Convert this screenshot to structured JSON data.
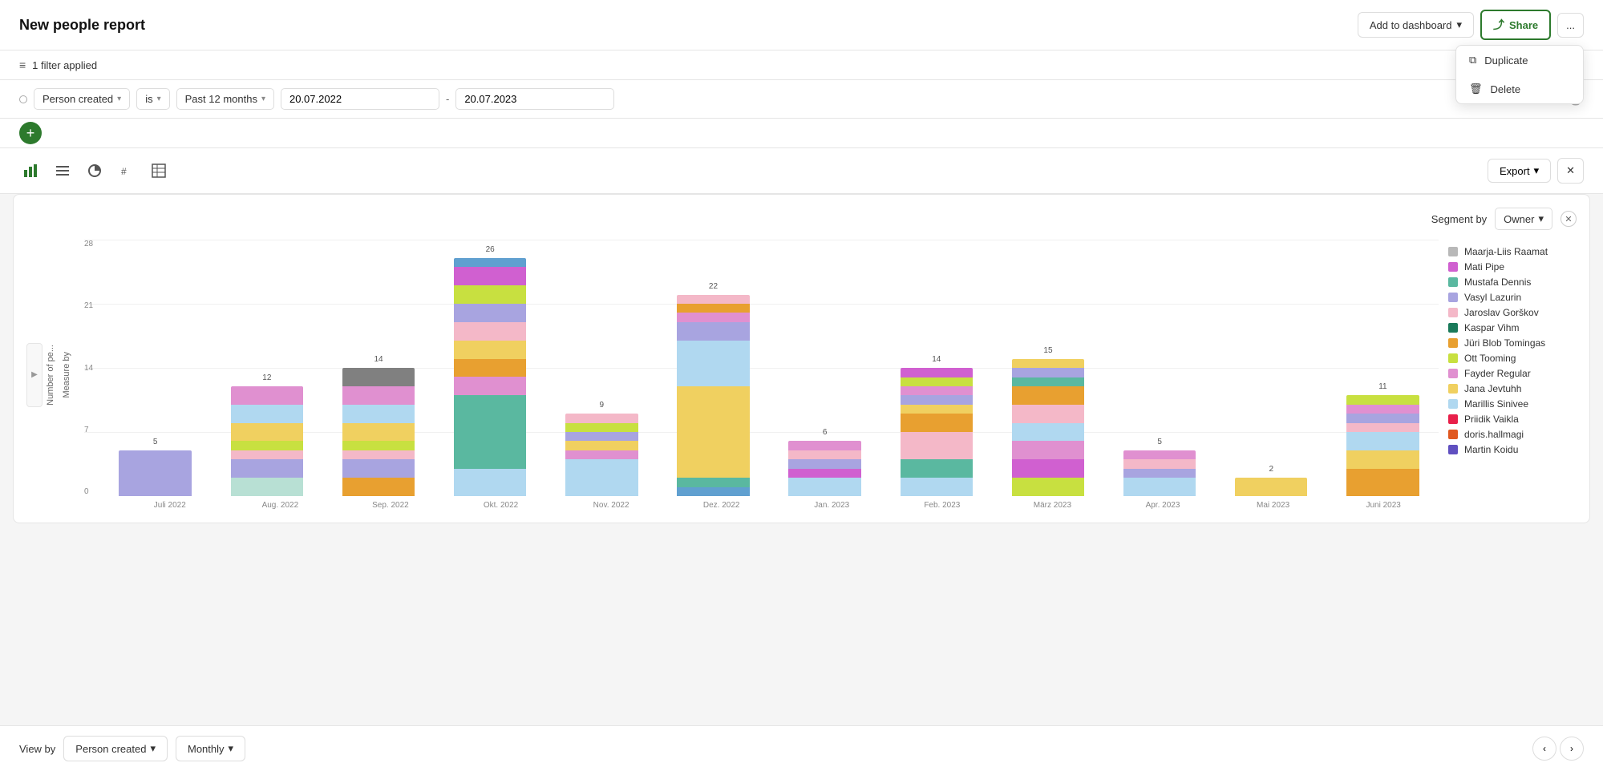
{
  "header": {
    "title": "New people report",
    "add_to_dashboard_label": "Add to dashboard",
    "share_label": "Share",
    "more_label": "...",
    "dropdown": {
      "duplicate_label": "Duplicate",
      "delete_label": "Delete"
    }
  },
  "filter_bar": {
    "filter_count": "1 filter applied"
  },
  "filter_row": {
    "field_label": "Person created",
    "operator_label": "is",
    "range_label": "Past 12 months",
    "date_from": "20.07.2022",
    "date_to": "20.07.2023"
  },
  "chart_toolbar": {
    "export_label": "Export"
  },
  "chart": {
    "y_axis_label": "Number of pe...",
    "x_axis_label": "Measure by",
    "segment_by_label": "Segment by",
    "owner_label": "Owner",
    "y_ticks": [
      "28",
      "21",
      "14",
      "7",
      "0"
    ],
    "bars": [
      {
        "label": "Juli 2022",
        "total": 5,
        "segments": [
          {
            "color": "#a8a4e0",
            "value": 5
          }
        ]
      },
      {
        "label": "Aug. 2022",
        "total": 12,
        "segments": [
          {
            "color": "#b8e0d4",
            "value": 2
          },
          {
            "color": "#a8a4e0",
            "value": 2
          },
          {
            "color": "#f4b8c8",
            "value": 1
          },
          {
            "color": "#c8e040",
            "value": 1
          },
          {
            "color": "#f0d060",
            "value": 2
          },
          {
            "color": "#b0d8f0",
            "value": 2
          },
          {
            "color": "#e090d0",
            "value": 2
          }
        ]
      },
      {
        "label": "Sep. 2022",
        "total": 14,
        "segments": [
          {
            "color": "#e8a030",
            "value": 2
          },
          {
            "color": "#a8a4e0",
            "value": 2
          },
          {
            "color": "#f4b8c8",
            "value": 1
          },
          {
            "color": "#c8e040",
            "value": 1
          },
          {
            "color": "#f0d060",
            "value": 2
          },
          {
            "color": "#b0d8f0",
            "value": 2
          },
          {
            "color": "#e090d0",
            "value": 2
          },
          {
            "color": "#808080",
            "value": 2
          }
        ]
      },
      {
        "label": "Okt. 2022",
        "total": 26,
        "segments": [
          {
            "color": "#b0d8f0",
            "value": 3
          },
          {
            "color": "#5ab8a0",
            "value": 8
          },
          {
            "color": "#e090d0",
            "value": 2
          },
          {
            "color": "#e8a030",
            "value": 2
          },
          {
            "color": "#f0d060",
            "value": 2
          },
          {
            "color": "#f4b8c8",
            "value": 2
          },
          {
            "color": "#a8a4e0",
            "value": 2
          },
          {
            "color": "#c8e040",
            "value": 2
          },
          {
            "color": "#d060d0",
            "value": 2
          },
          {
            "color": "#60a0d0",
            "value": 1
          }
        ]
      },
      {
        "label": "Nov. 2022",
        "total": 9,
        "segments": [
          {
            "color": "#b0d8f0",
            "value": 4
          },
          {
            "color": "#e090d0",
            "value": 1
          },
          {
            "color": "#f0d060",
            "value": 1
          },
          {
            "color": "#a8a4e0",
            "value": 1
          },
          {
            "color": "#c8e040",
            "value": 1
          },
          {
            "color": "#f4b8c8",
            "value": 1
          }
        ]
      },
      {
        "label": "Dez. 2022",
        "total": 22,
        "segments": [
          {
            "color": "#60a0d0",
            "value": 1
          },
          {
            "color": "#5ab8a0",
            "value": 1
          },
          {
            "color": "#f0d060",
            "value": 10
          },
          {
            "color": "#b0d8f0",
            "value": 5
          },
          {
            "color": "#a8a4e0",
            "value": 2
          },
          {
            "color": "#e090d0",
            "value": 1
          },
          {
            "color": "#e8a030",
            "value": 1
          },
          {
            "color": "#f4b8c8",
            "value": 1
          }
        ]
      },
      {
        "label": "Jan. 2023",
        "total": 6,
        "segments": [
          {
            "color": "#b0d8f0",
            "value": 2
          },
          {
            "color": "#d060d0",
            "value": 1
          },
          {
            "color": "#a8a4e0",
            "value": 1
          },
          {
            "color": "#f4b8c8",
            "value": 1
          },
          {
            "color": "#e090d0",
            "value": 1
          }
        ]
      },
      {
        "label": "Feb. 2023",
        "total": 14,
        "segments": [
          {
            "color": "#b0d8f0",
            "value": 2
          },
          {
            "color": "#5ab8a0",
            "value": 2
          },
          {
            "color": "#f4b8c8",
            "value": 3
          },
          {
            "color": "#e8a030",
            "value": 2
          },
          {
            "color": "#f0d060",
            "value": 1
          },
          {
            "color": "#a8a4e0",
            "value": 1
          },
          {
            "color": "#e090d0",
            "value": 1
          },
          {
            "color": "#c8e040",
            "value": 1
          },
          {
            "color": "#d060d0",
            "value": 1
          }
        ]
      },
      {
        "label": "März 2023",
        "total": 15,
        "segments": [
          {
            "color": "#c8e040",
            "value": 2
          },
          {
            "color": "#d060d0",
            "value": 2
          },
          {
            "color": "#e090d0",
            "value": 2
          },
          {
            "color": "#b0d8f0",
            "value": 2
          },
          {
            "color": "#f4b8c8",
            "value": 2
          },
          {
            "color": "#e8a030",
            "value": 2
          },
          {
            "color": "#5ab8a0",
            "value": 1
          },
          {
            "color": "#a8a4e0",
            "value": 1
          },
          {
            "color": "#f0d060",
            "value": 1
          }
        ]
      },
      {
        "label": "Apr. 2023",
        "total": 5,
        "segments": [
          {
            "color": "#b0d8f0",
            "value": 2
          },
          {
            "color": "#a8a4e0",
            "value": 1
          },
          {
            "color": "#f4b8c8",
            "value": 1
          },
          {
            "color": "#e090d0",
            "value": 1
          }
        ]
      },
      {
        "label": "Mai 2023",
        "total": 2,
        "segments": [
          {
            "color": "#f0d060",
            "value": 2
          }
        ]
      },
      {
        "label": "Juni 2023",
        "total": 11,
        "segments": [
          {
            "color": "#e8a030",
            "value": 3
          },
          {
            "color": "#f0d060",
            "value": 2
          },
          {
            "color": "#b0d8f0",
            "value": 2
          },
          {
            "color": "#f4b8c8",
            "value": 1
          },
          {
            "color": "#a8a4e0",
            "value": 1
          },
          {
            "color": "#e090d0",
            "value": 1
          },
          {
            "color": "#c8e040",
            "value": 1
          }
        ]
      }
    ],
    "max_value": 28
  },
  "legend": {
    "items": [
      {
        "color": "#b8b8b8",
        "label": "Maarja-Liis Raamat"
      },
      {
        "color": "#d060d0",
        "label": "Mati Pipe"
      },
      {
        "color": "#5ab8a0",
        "label": "Mustafa Dennis"
      },
      {
        "color": "#a8a4e0",
        "label": "Vasyl Lazurin"
      },
      {
        "color": "#f4b8c8",
        "label": "Jaroslav Gorškov"
      },
      {
        "color": "#1a7a5a",
        "label": "Kaspar Vihm"
      },
      {
        "color": "#e8a030",
        "label": "Jüri Blob Tomingas"
      },
      {
        "color": "#c8e040",
        "label": "Ott Tooming"
      },
      {
        "color": "#e090d0",
        "label": "Fayder Regular"
      },
      {
        "color": "#f0d060",
        "label": "Jana Jevtuhh"
      },
      {
        "color": "#b0d8f0",
        "label": "Marillis Sinivee"
      },
      {
        "color": "#e8204a",
        "label": "Priidik Vaikla"
      },
      {
        "color": "#e05820",
        "label": "doris.hallmagi"
      },
      {
        "color": "#6050c0",
        "label": "Martin Koidu"
      }
    ]
  },
  "bottom_bar": {
    "view_by_label": "View by",
    "person_created_label": "Person created",
    "monthly_label": "Monthly"
  }
}
